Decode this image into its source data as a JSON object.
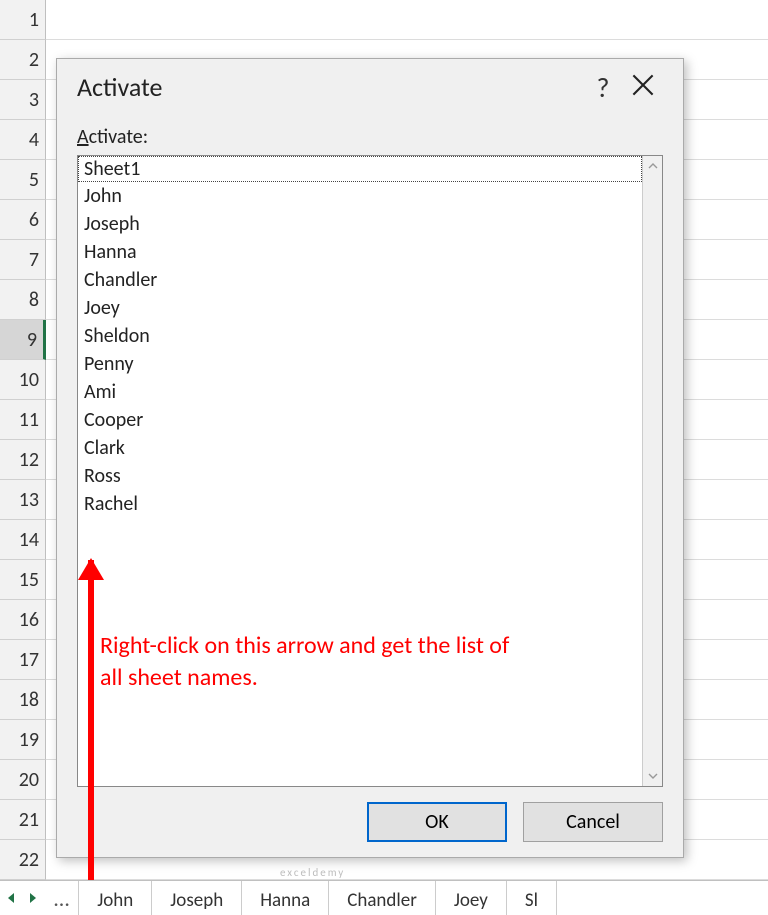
{
  "rows": [
    "1",
    "2",
    "3",
    "4",
    "5",
    "6",
    "7",
    "8",
    "9",
    "10",
    "11",
    "12",
    "13",
    "14",
    "15",
    "16",
    "17",
    "18",
    "19",
    "20",
    "21",
    "22"
  ],
  "selected_row_index": 8,
  "dialog": {
    "title": "Activate",
    "label_prefix": "A",
    "label_rest": "ctivate:",
    "items": [
      "Sheet1",
      "John",
      "Joseph",
      "Hanna",
      "Chandler",
      "Joey",
      "Sheldon",
      "Penny",
      "Ami",
      "Cooper",
      "Clark",
      "Ross",
      "Rachel"
    ],
    "selected_index": 0,
    "help": "?",
    "ok": "OK",
    "cancel": "Cancel"
  },
  "tabs": [
    "John",
    "Joseph",
    "Hanna",
    "Chandler",
    "Joey",
    "Sl"
  ],
  "nav_dots": "…",
  "annotation": "Right-click on this arrow and get the list of all sheet names.",
  "watermark": "exceldemy"
}
